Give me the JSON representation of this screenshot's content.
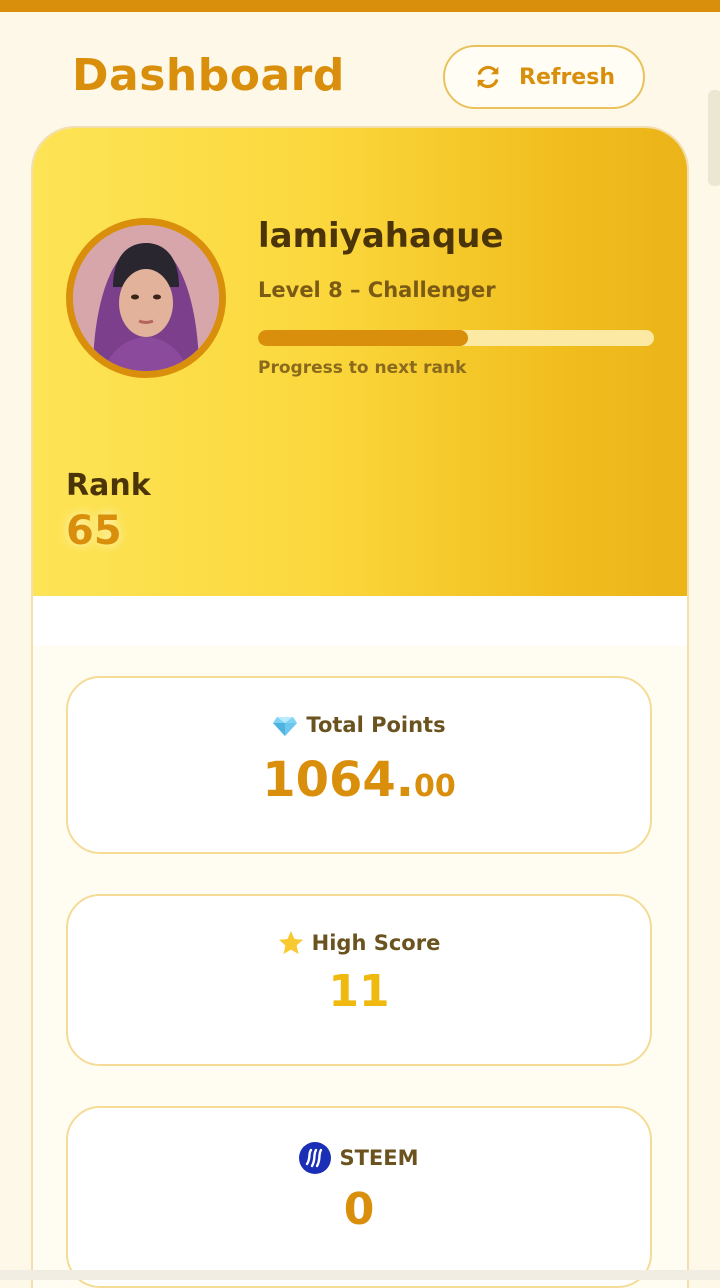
{
  "header": {
    "title": "Dashboard",
    "refresh_label": "Refresh"
  },
  "profile": {
    "username": "lamiyahaque",
    "level": "Level 8 – Challenger",
    "progress_fraction": 0.53,
    "progress_label": "Progress to next rank",
    "rank_label": "Rank",
    "rank_value": "65"
  },
  "stats": {
    "total_points": {
      "label": "Total Points",
      "integer": "1064.",
      "decimal": "00",
      "icon": "gem-icon"
    },
    "high_score": {
      "label": "High Score",
      "value": "11",
      "icon": "star-icon"
    },
    "steem": {
      "label": "STEEM",
      "value": "0",
      "icon": "steem-icon"
    }
  },
  "colors": {
    "accent": "#d98f0b",
    "hero_gradient_start": "#fde456",
    "hero_gradient_end": "#ebb419",
    "card_border": "#f4dc96",
    "steem_blue": "#1a2fb5"
  }
}
